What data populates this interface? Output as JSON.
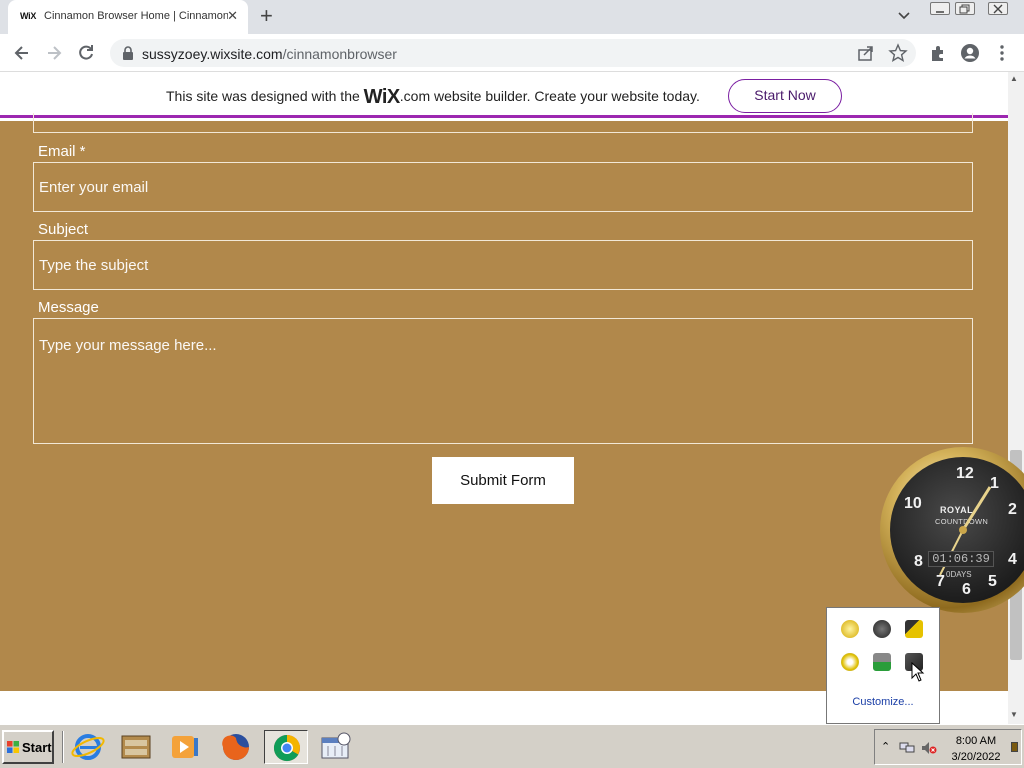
{
  "browser": {
    "tab": {
      "favicon_text": "WiX",
      "title": "Cinnamon Browser Home | Cinnamon Browser"
    },
    "address": {
      "host": "sussyzoey.wixsite.com",
      "path": "/cinnamonbrowser"
    }
  },
  "wix_banner": {
    "message_before": "This site was designed with the ",
    "logo": "WiX",
    "message_after": ".com website builder. Create your website today.",
    "button_label": "Start Now"
  },
  "form": {
    "email_label": "Email *",
    "email_placeholder": "Enter your email",
    "subject_label": "Subject",
    "subject_placeholder": "Type the subject",
    "message_label": "Message",
    "message_placeholder": "Type your message here...",
    "submit_label": "Submit Form"
  },
  "clock_gadget": {
    "brand": "ROYAL",
    "brand_sub": "COUNTDOWN",
    "digital": "01:06:39",
    "days": "0DAYS"
  },
  "tray_popup": {
    "customize_label": "Customize..."
  },
  "taskbar": {
    "start_label": "Start",
    "time": "8:00 AM",
    "date": "3/20/2022"
  },
  "colors": {
    "page_bg": "#b1884b",
    "wix_accent": "#9c27b0"
  }
}
